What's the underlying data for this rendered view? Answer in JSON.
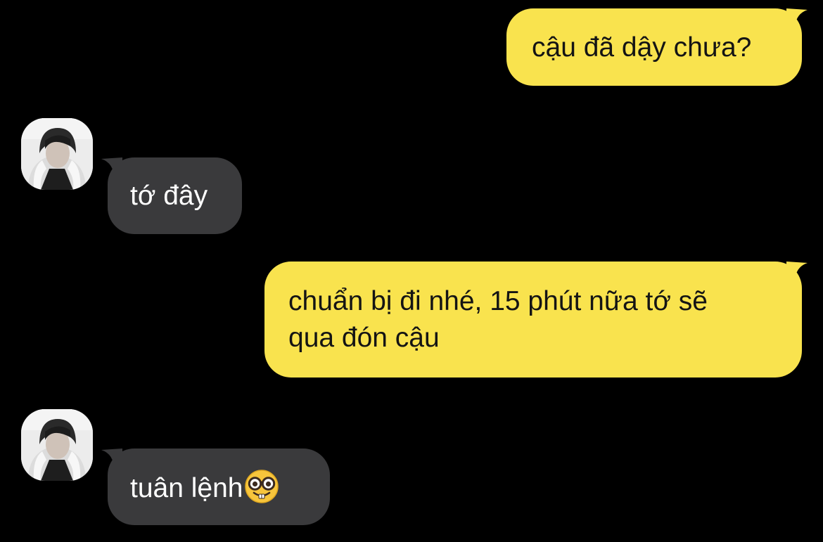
{
  "colors": {
    "background": "#000000",
    "outgoing_bubble": "#f9e34e",
    "incoming_bubble": "#3a3a3c",
    "outgoing_text": "#141414",
    "incoming_text": "#ffffff"
  },
  "messages": [
    {
      "direction": "outgoing",
      "text": "cậu đã dậy chưa?"
    },
    {
      "direction": "incoming",
      "text": "tớ đây",
      "avatar": "contact-avatar"
    },
    {
      "direction": "outgoing",
      "lines": [
        "chuẩn bị đi nhé, 15 phút nữa tớ sẽ",
        "qua đón cậu"
      ]
    },
    {
      "direction": "incoming",
      "text": "tuân lệnh",
      "emoji": "nerd-face-emoji",
      "avatar": "contact-avatar"
    }
  ]
}
